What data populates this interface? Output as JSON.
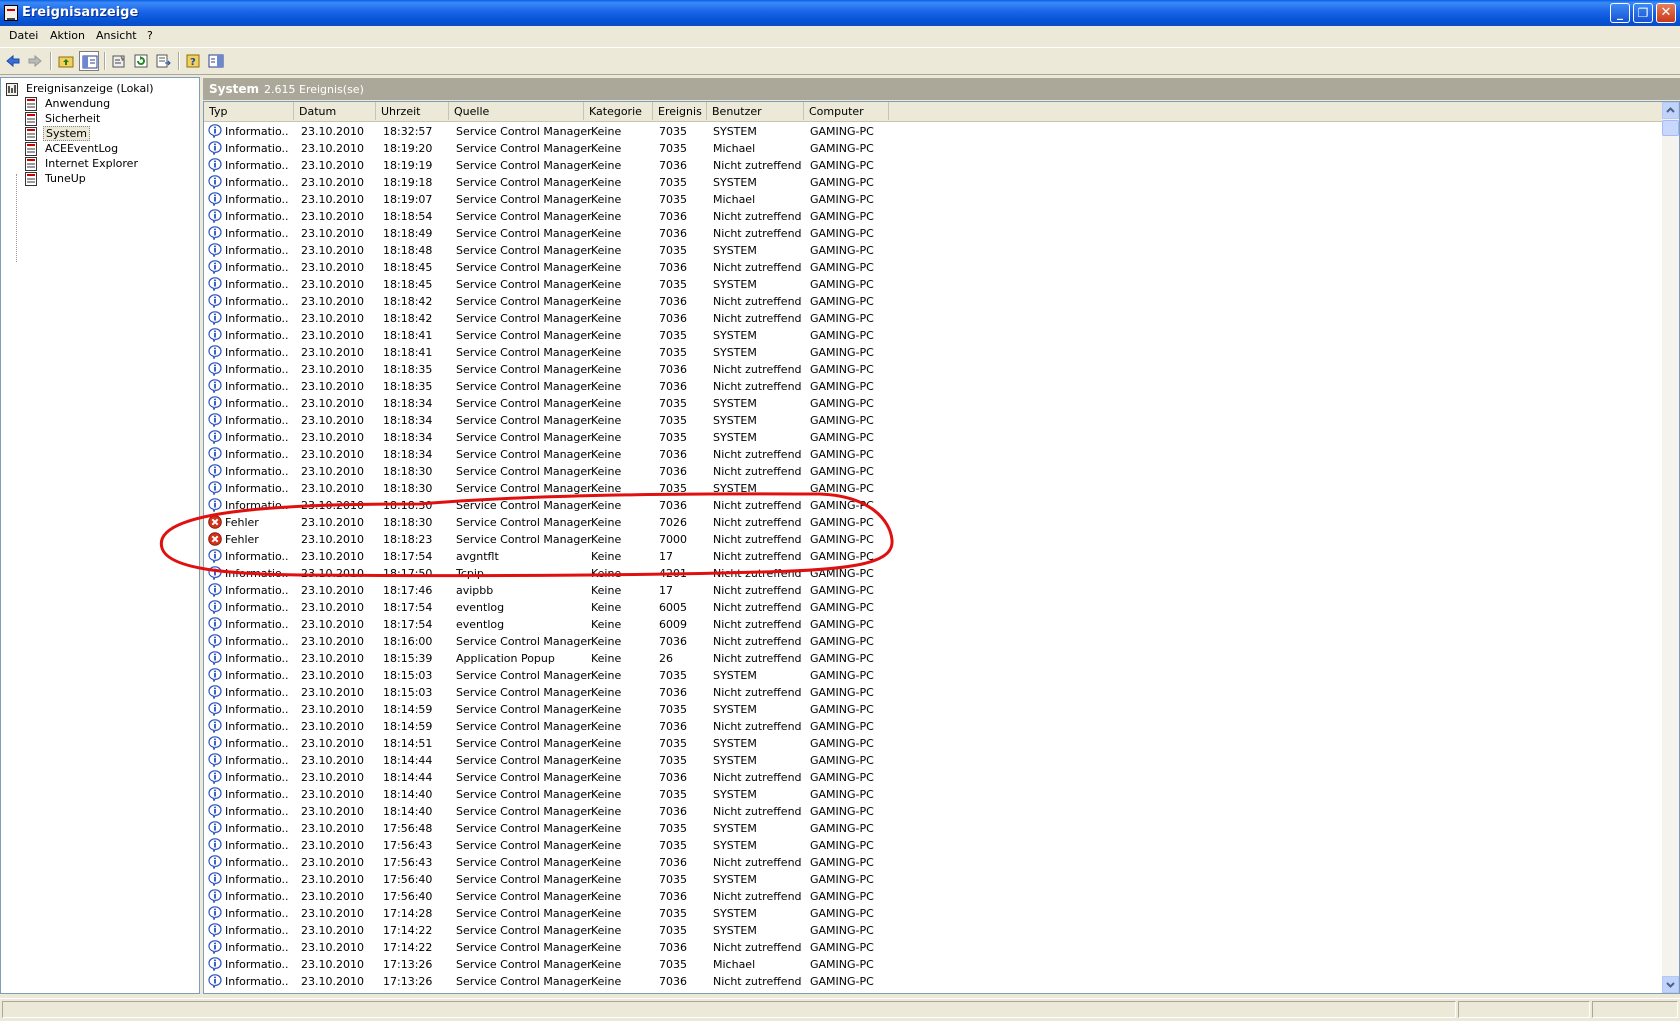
{
  "window": {
    "title": "Ereignisanzeige"
  },
  "menu": [
    "Datei",
    "Aktion",
    "Ansicht",
    "?"
  ],
  "tree": {
    "root": "Ereignisanzeige (Lokal)",
    "items": [
      "Anwendung",
      "Sicherheit",
      "System",
      "ACEEventLog",
      "Internet Explorer",
      "TuneUp"
    ],
    "selected": "System"
  },
  "pane": {
    "name": "System",
    "count": "2.615 Ereignis(se)"
  },
  "columns": [
    "Typ",
    "Datum",
    "Uhrzeit",
    "Quelle",
    "Kategorie",
    "Ereignis",
    "Benutzer",
    "Computer"
  ],
  "rows": [
    [
      "info",
      "Informatio...",
      "23.10.2010",
      "18:32:57",
      "Service Control Manager",
      "Keine",
      "7035",
      "SYSTEM",
      "GAMING-PC"
    ],
    [
      "info",
      "Informatio...",
      "23.10.2010",
      "18:19:20",
      "Service Control Manager",
      "Keine",
      "7035",
      "Michael",
      "GAMING-PC"
    ],
    [
      "info",
      "Informatio...",
      "23.10.2010",
      "18:19:19",
      "Service Control Manager",
      "Keine",
      "7036",
      "Nicht zutreffend",
      "GAMING-PC"
    ],
    [
      "info",
      "Informatio...",
      "23.10.2010",
      "18:19:18",
      "Service Control Manager",
      "Keine",
      "7035",
      "SYSTEM",
      "GAMING-PC"
    ],
    [
      "info",
      "Informatio...",
      "23.10.2010",
      "18:19:07",
      "Service Control Manager",
      "Keine",
      "7035",
      "Michael",
      "GAMING-PC"
    ],
    [
      "info",
      "Informatio...",
      "23.10.2010",
      "18:18:54",
      "Service Control Manager",
      "Keine",
      "7036",
      "Nicht zutreffend",
      "GAMING-PC"
    ],
    [
      "info",
      "Informatio...",
      "23.10.2010",
      "18:18:49",
      "Service Control Manager",
      "Keine",
      "7036",
      "Nicht zutreffend",
      "GAMING-PC"
    ],
    [
      "info",
      "Informatio...",
      "23.10.2010",
      "18:18:48",
      "Service Control Manager",
      "Keine",
      "7035",
      "SYSTEM",
      "GAMING-PC"
    ],
    [
      "info",
      "Informatio...",
      "23.10.2010",
      "18:18:45",
      "Service Control Manager",
      "Keine",
      "7036",
      "Nicht zutreffend",
      "GAMING-PC"
    ],
    [
      "info",
      "Informatio...",
      "23.10.2010",
      "18:18:45",
      "Service Control Manager",
      "Keine",
      "7035",
      "SYSTEM",
      "GAMING-PC"
    ],
    [
      "info",
      "Informatio...",
      "23.10.2010",
      "18:18:42",
      "Service Control Manager",
      "Keine",
      "7036",
      "Nicht zutreffend",
      "GAMING-PC"
    ],
    [
      "info",
      "Informatio...",
      "23.10.2010",
      "18:18:42",
      "Service Control Manager",
      "Keine",
      "7036",
      "Nicht zutreffend",
      "GAMING-PC"
    ],
    [
      "info",
      "Informatio...",
      "23.10.2010",
      "18:18:41",
      "Service Control Manager",
      "Keine",
      "7035",
      "SYSTEM",
      "GAMING-PC"
    ],
    [
      "info",
      "Informatio...",
      "23.10.2010",
      "18:18:41",
      "Service Control Manager",
      "Keine",
      "7035",
      "SYSTEM",
      "GAMING-PC"
    ],
    [
      "info",
      "Informatio...",
      "23.10.2010",
      "18:18:35",
      "Service Control Manager",
      "Keine",
      "7036",
      "Nicht zutreffend",
      "GAMING-PC"
    ],
    [
      "info",
      "Informatio...",
      "23.10.2010",
      "18:18:35",
      "Service Control Manager",
      "Keine",
      "7036",
      "Nicht zutreffend",
      "GAMING-PC"
    ],
    [
      "info",
      "Informatio...",
      "23.10.2010",
      "18:18:34",
      "Service Control Manager",
      "Keine",
      "7035",
      "SYSTEM",
      "GAMING-PC"
    ],
    [
      "info",
      "Informatio...",
      "23.10.2010",
      "18:18:34",
      "Service Control Manager",
      "Keine",
      "7035",
      "SYSTEM",
      "GAMING-PC"
    ],
    [
      "info",
      "Informatio...",
      "23.10.2010",
      "18:18:34",
      "Service Control Manager",
      "Keine",
      "7035",
      "SYSTEM",
      "GAMING-PC"
    ],
    [
      "info",
      "Informatio...",
      "23.10.2010",
      "18:18:34",
      "Service Control Manager",
      "Keine",
      "7036",
      "Nicht zutreffend",
      "GAMING-PC"
    ],
    [
      "info",
      "Informatio...",
      "23.10.2010",
      "18:18:30",
      "Service Control Manager",
      "Keine",
      "7036",
      "Nicht zutreffend",
      "GAMING-PC"
    ],
    [
      "info",
      "Informatio...",
      "23.10.2010",
      "18:18:30",
      "Service Control Manager",
      "Keine",
      "7035",
      "SYSTEM",
      "GAMING-PC"
    ],
    [
      "info",
      "Informatio...",
      "23.10.2010",
      "18:18:30",
      "Service Control Manager",
      "Keine",
      "7036",
      "Nicht zutreffend",
      "GAMING-PC"
    ],
    [
      "error",
      "Fehler",
      "23.10.2010",
      "18:18:30",
      "Service Control Manager",
      "Keine",
      "7026",
      "Nicht zutreffend",
      "GAMING-PC"
    ],
    [
      "error",
      "Fehler",
      "23.10.2010",
      "18:18:23",
      "Service Control Manager",
      "Keine",
      "7000",
      "Nicht zutreffend",
      "GAMING-PC"
    ],
    [
      "info",
      "Informatio...",
      "23.10.2010",
      "18:17:54",
      "avgntflt",
      "Keine",
      "17",
      "Nicht zutreffend",
      "GAMING-PC"
    ],
    [
      "info",
      "Informatio...",
      "23.10.2010",
      "18:17:50",
      "Tcpip",
      "Keine",
      "4201",
      "Nicht zutreffend",
      "GAMING-PC"
    ],
    [
      "info",
      "Informatio...",
      "23.10.2010",
      "18:17:46",
      "avipbb",
      "Keine",
      "17",
      "Nicht zutreffend",
      "GAMING-PC"
    ],
    [
      "info",
      "Informatio...",
      "23.10.2010",
      "18:17:54",
      "eventlog",
      "Keine",
      "6005",
      "Nicht zutreffend",
      "GAMING-PC"
    ],
    [
      "info",
      "Informatio...",
      "23.10.2010",
      "18:17:54",
      "eventlog",
      "Keine",
      "6009",
      "Nicht zutreffend",
      "GAMING-PC"
    ],
    [
      "info",
      "Informatio...",
      "23.10.2010",
      "18:16:00",
      "Service Control Manager",
      "Keine",
      "7036",
      "Nicht zutreffend",
      "GAMING-PC"
    ],
    [
      "info",
      "Informatio...",
      "23.10.2010",
      "18:15:39",
      "Application Popup",
      "Keine",
      "26",
      "Nicht zutreffend",
      "GAMING-PC"
    ],
    [
      "info",
      "Informatio...",
      "23.10.2010",
      "18:15:03",
      "Service Control Manager",
      "Keine",
      "7035",
      "SYSTEM",
      "GAMING-PC"
    ],
    [
      "info",
      "Informatio...",
      "23.10.2010",
      "18:15:03",
      "Service Control Manager",
      "Keine",
      "7036",
      "Nicht zutreffend",
      "GAMING-PC"
    ],
    [
      "info",
      "Informatio...",
      "23.10.2010",
      "18:14:59",
      "Service Control Manager",
      "Keine",
      "7035",
      "SYSTEM",
      "GAMING-PC"
    ],
    [
      "info",
      "Informatio...",
      "23.10.2010",
      "18:14:59",
      "Service Control Manager",
      "Keine",
      "7036",
      "Nicht zutreffend",
      "GAMING-PC"
    ],
    [
      "info",
      "Informatio...",
      "23.10.2010",
      "18:14:51",
      "Service Control Manager",
      "Keine",
      "7035",
      "SYSTEM",
      "GAMING-PC"
    ],
    [
      "info",
      "Informatio...",
      "23.10.2010",
      "18:14:44",
      "Service Control Manager",
      "Keine",
      "7035",
      "SYSTEM",
      "GAMING-PC"
    ],
    [
      "info",
      "Informatio...",
      "23.10.2010",
      "18:14:44",
      "Service Control Manager",
      "Keine",
      "7036",
      "Nicht zutreffend",
      "GAMING-PC"
    ],
    [
      "info",
      "Informatio...",
      "23.10.2010",
      "18:14:40",
      "Service Control Manager",
      "Keine",
      "7035",
      "SYSTEM",
      "GAMING-PC"
    ],
    [
      "info",
      "Informatio...",
      "23.10.2010",
      "18:14:40",
      "Service Control Manager",
      "Keine",
      "7036",
      "Nicht zutreffend",
      "GAMING-PC"
    ],
    [
      "info",
      "Informatio...",
      "23.10.2010",
      "17:56:48",
      "Service Control Manager",
      "Keine",
      "7035",
      "SYSTEM",
      "GAMING-PC"
    ],
    [
      "info",
      "Informatio...",
      "23.10.2010",
      "17:56:43",
      "Service Control Manager",
      "Keine",
      "7035",
      "SYSTEM",
      "GAMING-PC"
    ],
    [
      "info",
      "Informatio...",
      "23.10.2010",
      "17:56:43",
      "Service Control Manager",
      "Keine",
      "7036",
      "Nicht zutreffend",
      "GAMING-PC"
    ],
    [
      "info",
      "Informatio...",
      "23.10.2010",
      "17:56:40",
      "Service Control Manager",
      "Keine",
      "7035",
      "SYSTEM",
      "GAMING-PC"
    ],
    [
      "info",
      "Informatio...",
      "23.10.2010",
      "17:56:40",
      "Service Control Manager",
      "Keine",
      "7036",
      "Nicht zutreffend",
      "GAMING-PC"
    ],
    [
      "info",
      "Informatio...",
      "23.10.2010",
      "17:14:28",
      "Service Control Manager",
      "Keine",
      "7035",
      "SYSTEM",
      "GAMING-PC"
    ],
    [
      "info",
      "Informatio...",
      "23.10.2010",
      "17:14:22",
      "Service Control Manager",
      "Keine",
      "7035",
      "SYSTEM",
      "GAMING-PC"
    ],
    [
      "info",
      "Informatio...",
      "23.10.2010",
      "17:14:22",
      "Service Control Manager",
      "Keine",
      "7036",
      "Nicht zutreffend",
      "GAMING-PC"
    ],
    [
      "info",
      "Informatio...",
      "23.10.2010",
      "17:13:26",
      "Service Control Manager",
      "Keine",
      "7035",
      "Michael",
      "GAMING-PC"
    ],
    [
      "info",
      "Informatio...",
      "23.10.2010",
      "17:13:26",
      "Service Control Manager",
      "Keine",
      "7036",
      "Nicht zutreffend",
      "GAMING-PC"
    ]
  ],
  "colors": {
    "title_bar": "#0a5ee8",
    "error_icon": "#d6301c",
    "info_icon": "#2a52be",
    "annotation": "#e01010"
  }
}
